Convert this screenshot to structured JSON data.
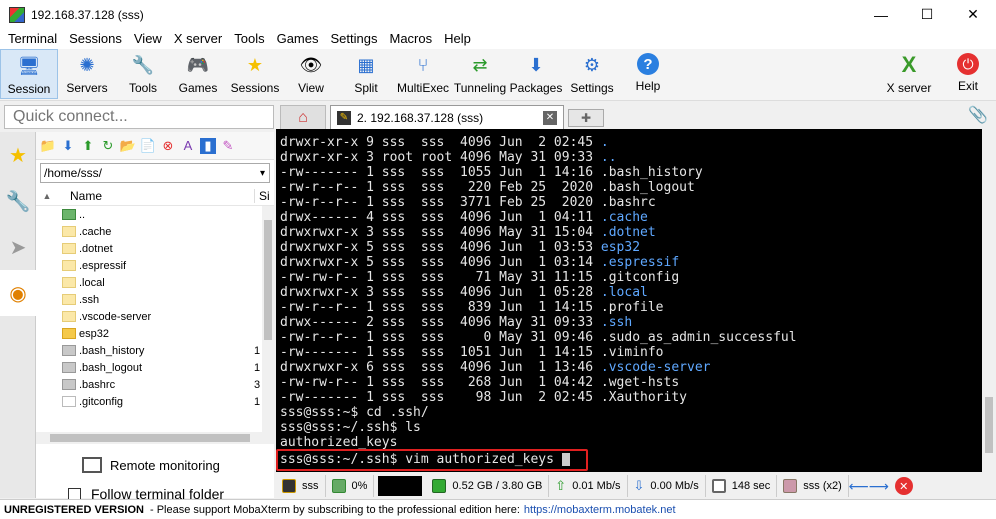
{
  "window": {
    "title": "192.168.37.128 (sss)",
    "min": "—",
    "max": "☐",
    "close": "✕"
  },
  "menu": [
    "Terminal",
    "Sessions",
    "View",
    "X server",
    "Tools",
    "Games",
    "Settings",
    "Macros",
    "Help"
  ],
  "toolbar": {
    "items": [
      {
        "label": "Session",
        "icon": "session-icon",
        "glyph": "🖥",
        "active": true
      },
      {
        "label": "Servers",
        "icon": "servers-icon",
        "glyph": "✺"
      },
      {
        "label": "Tools",
        "icon": "tools-icon",
        "glyph": "🔧"
      },
      {
        "label": "Games",
        "icon": "games-icon",
        "glyph": "🎮"
      },
      {
        "label": "Sessions",
        "icon": "star-icon",
        "glyph": "★"
      },
      {
        "label": "View",
        "icon": "view-icon",
        "glyph": "👁"
      },
      {
        "label": "Split",
        "icon": "split-icon",
        "glyph": "▦"
      },
      {
        "label": "MultiExec",
        "icon": "multiexec-icon",
        "glyph": "⑂"
      },
      {
        "label": "Tunneling",
        "icon": "tunneling-icon",
        "glyph": "⇄"
      },
      {
        "label": "Packages",
        "icon": "packages-icon",
        "glyph": "⬇"
      },
      {
        "label": "Settings",
        "icon": "settings-icon",
        "glyph": "⚙"
      },
      {
        "label": "Help",
        "icon": "help-icon",
        "glyph": "?"
      }
    ],
    "right": [
      {
        "label": "X server",
        "icon": "xserver-icon",
        "glyph": "X"
      },
      {
        "label": "Exit",
        "icon": "exit-icon",
        "glyph": "⏻"
      }
    ]
  },
  "quick_connect": {
    "placeholder": "Quick connect..."
  },
  "file_browser": {
    "path": "/home/sss/",
    "col_name": "Name",
    "col_size": "Si",
    "rows": [
      {
        "name": "..",
        "type": "up",
        "size": ""
      },
      {
        "name": ".cache",
        "type": "folder hidden",
        "size": ""
      },
      {
        "name": ".dotnet",
        "type": "folder hidden",
        "size": ""
      },
      {
        "name": ".espressif",
        "type": "folder hidden",
        "size": ""
      },
      {
        "name": ".local",
        "type": "folder hidden",
        "size": ""
      },
      {
        "name": ".ssh",
        "type": "folder hidden",
        "size": ""
      },
      {
        "name": ".vscode-server",
        "type": "folder hidden",
        "size": ""
      },
      {
        "name": "esp32",
        "type": "folder",
        "size": ""
      },
      {
        "name": ".bash_history",
        "type": "file",
        "size": "1"
      },
      {
        "name": ".bash_logout",
        "type": "file",
        "size": "1"
      },
      {
        "name": ".bashrc",
        "type": "file",
        "size": "3"
      },
      {
        "name": ".gitconfig",
        "type": "file",
        "size": "1"
      }
    ],
    "remote_monitoring": "Remote monitoring",
    "follow_folder": "Follow terminal folder"
  },
  "tabs": {
    "active_label": "2. 192.168.37.128 (sss)"
  },
  "terminal": {
    "lines": [
      {
        "text": "drwxr-xr-x 9 sss  sss  4096 Jun  2 02:45 ",
        "dir": "."
      },
      {
        "text": "drwxr-xr-x 3 root root 4096 May 31 09:33 ",
        "dir": ".."
      },
      {
        "text": "-rw------- 1 sss  sss  1055 Jun  1 14:16 .bash_history",
        "dir": ""
      },
      {
        "text": "-rw-r--r-- 1 sss  sss   220 Feb 25  2020 .bash_logout",
        "dir": ""
      },
      {
        "text": "-rw-r--r-- 1 sss  sss  3771 Feb 25  2020 .bashrc",
        "dir": ""
      },
      {
        "text": "drwx------ 4 sss  sss  4096 Jun  1 04:11 ",
        "dir": ".cache"
      },
      {
        "text": "drwxrwxr-x 3 sss  sss  4096 May 31 15:04 ",
        "dir": ".dotnet"
      },
      {
        "text": "drwxrwxr-x 5 sss  sss  4096 Jun  1 03:53 ",
        "dir": "esp32"
      },
      {
        "text": "drwxrwxr-x 5 sss  sss  4096 Jun  1 03:14 ",
        "dir": ".espressif"
      },
      {
        "text": "-rw-rw-r-- 1 sss  sss    71 May 31 11:15 .gitconfig",
        "dir": ""
      },
      {
        "text": "drwxrwxr-x 3 sss  sss  4096 Jun  1 05:28 ",
        "dir": ".local"
      },
      {
        "text": "-rw-r--r-- 1 sss  sss   839 Jun  1 14:15 .profile",
        "dir": ""
      },
      {
        "text": "drwx------ 2 sss  sss  4096 May 31 09:33 ",
        "dir": ".ssh"
      },
      {
        "text": "-rw-r--r-- 1 sss  sss     0 May 31 09:46 .sudo_as_admin_successful",
        "dir": ""
      },
      {
        "text": "-rw------- 1 sss  sss  1051 Jun  1 14:15 .viminfo",
        "dir": ""
      },
      {
        "text": "drwxrwxr-x 6 sss  sss  4096 Jun  1 13:46 ",
        "dir": ".vscode-server"
      },
      {
        "text": "-rw-rw-r-- 1 sss  sss   268 Jun  1 04:42 .wget-hsts",
        "dir": ""
      },
      {
        "text": "-rw------- 1 sss  sss    98 Jun  2 02:45 .Xauthority",
        "dir": ""
      },
      {
        "text": "sss@sss:~$ cd .ssh/",
        "dir": ""
      },
      {
        "text": "sss@sss:~/.ssh$ ls",
        "dir": ""
      },
      {
        "text": "authorized_keys",
        "dir": ""
      }
    ],
    "current_command": "sss@sss:~/.ssh$ vim authorized_keys "
  },
  "status": {
    "session": "sss",
    "cpu": "0%",
    "memory": "0.52 GB / 3.80 GB",
    "upload": "0.01 Mb/s",
    "download": "0.00 Mb/s",
    "uptime": "148 sec",
    "users": "sss (x2)"
  },
  "banner": {
    "bold": "UNREGISTERED VERSION",
    "text": "-  Please support MobaXterm by subscribing to the professional edition here:",
    "link": "https://mobaxterm.mobatek.net"
  },
  "colors": {
    "dir": "#5fa8ff",
    "highlight": "#e02020",
    "accent": "#2a6fd0"
  }
}
